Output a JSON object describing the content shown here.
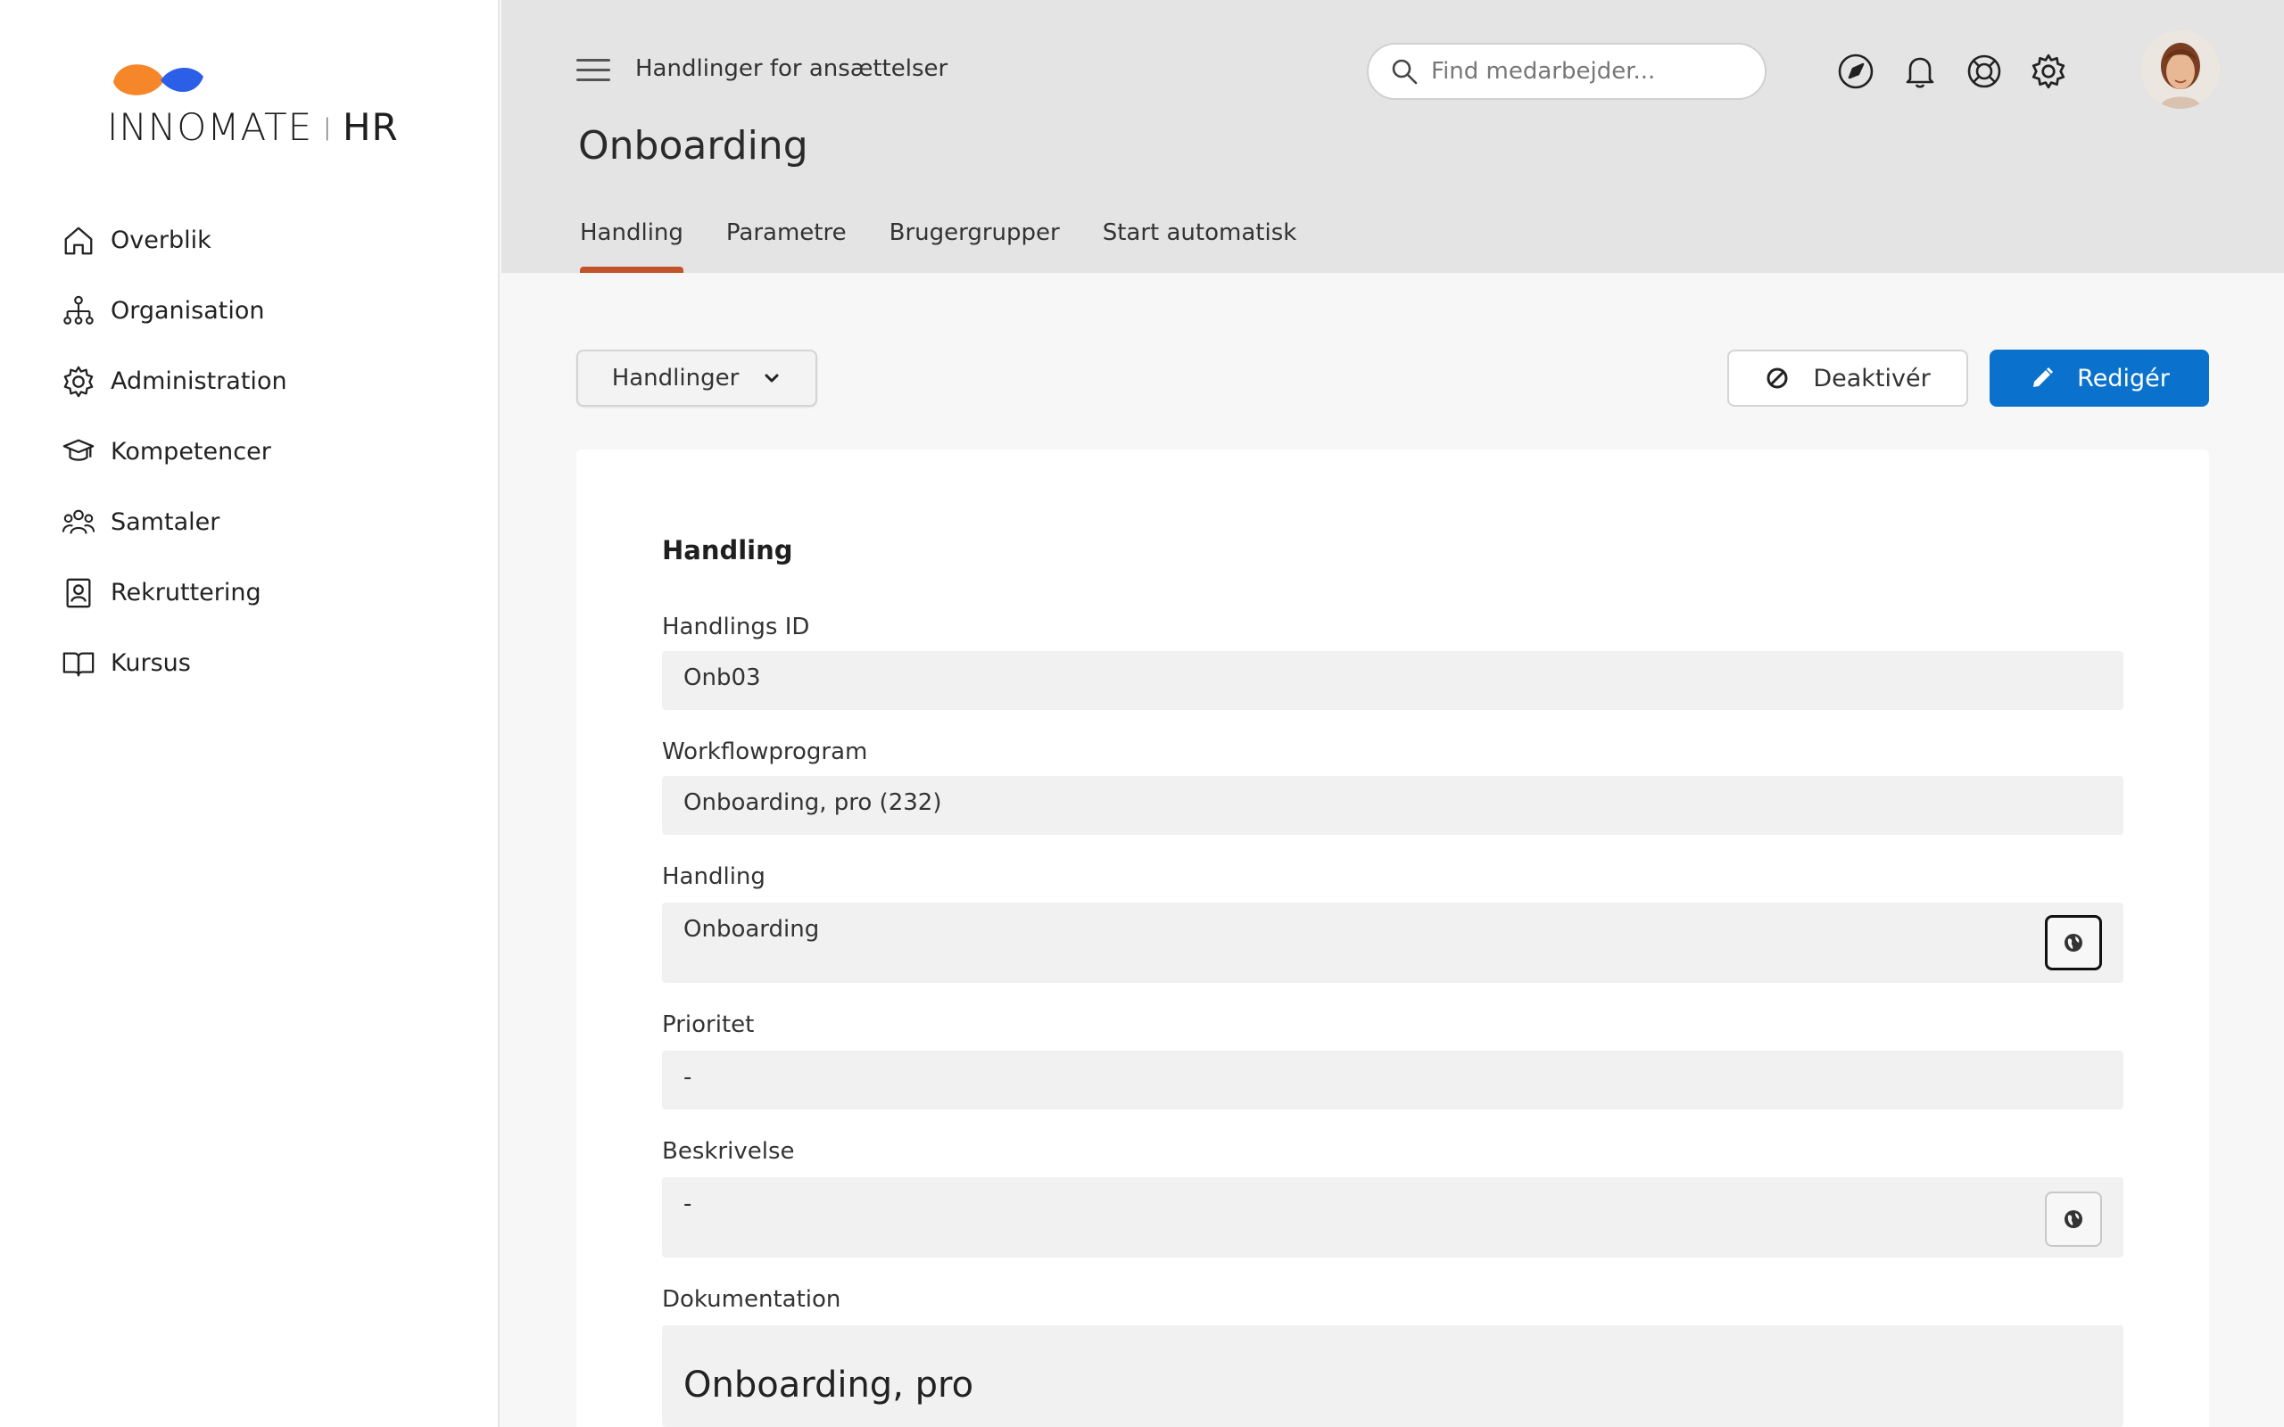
{
  "app": {
    "logo_text_main": "INNOMATE",
    "logo_text_sep": "|",
    "logo_text_suffix": "HR",
    "brand_colors": {
      "orange": "#f5862a",
      "blue": "#2c5fe8",
      "accent_tab": "#c1542a",
      "primary_button": "#0a72cc"
    }
  },
  "sidebar": {
    "items": [
      {
        "label": "Overblik",
        "icon": "home-icon"
      },
      {
        "label": "Organisation",
        "icon": "org-chart-icon"
      },
      {
        "label": "Administration",
        "icon": "gear-icon"
      },
      {
        "label": "Kompetencer",
        "icon": "graduation-cap-icon"
      },
      {
        "label": "Samtaler",
        "icon": "people-icon"
      },
      {
        "label": "Rekruttering",
        "icon": "id-badge-icon"
      },
      {
        "label": "Kursus",
        "icon": "open-book-icon"
      }
    ]
  },
  "header": {
    "breadcrumb": "Handlinger for ansættelser",
    "title": "Onboarding",
    "search_placeholder": "Find medarbejder...",
    "tabs": [
      {
        "label": "Handling",
        "active": true
      },
      {
        "label": "Parametre",
        "active": false
      },
      {
        "label": "Brugergrupper",
        "active": false
      },
      {
        "label": "Start automatisk",
        "active": false
      }
    ],
    "icons": [
      "navigation-icon",
      "bell-icon",
      "lifebuoy-icon",
      "settings-icon"
    ]
  },
  "toolbar": {
    "dropdown_label": "Handlinger",
    "deactivate_label": "Deaktivér",
    "edit_label": "Redigér"
  },
  "form": {
    "section_title": "Handling",
    "fields": [
      {
        "label": "Handlings ID",
        "value": "Onb03"
      },
      {
        "label": "Workflowprogram",
        "value": "Onboarding, pro (232)"
      },
      {
        "label": "Handling",
        "value": "Onboarding"
      },
      {
        "label": "Prioritet",
        "value": "-"
      },
      {
        "label": "Beskrivelse",
        "value": "-"
      },
      {
        "label": "Dokumentation",
        "value": "Onboarding, pro"
      }
    ]
  }
}
